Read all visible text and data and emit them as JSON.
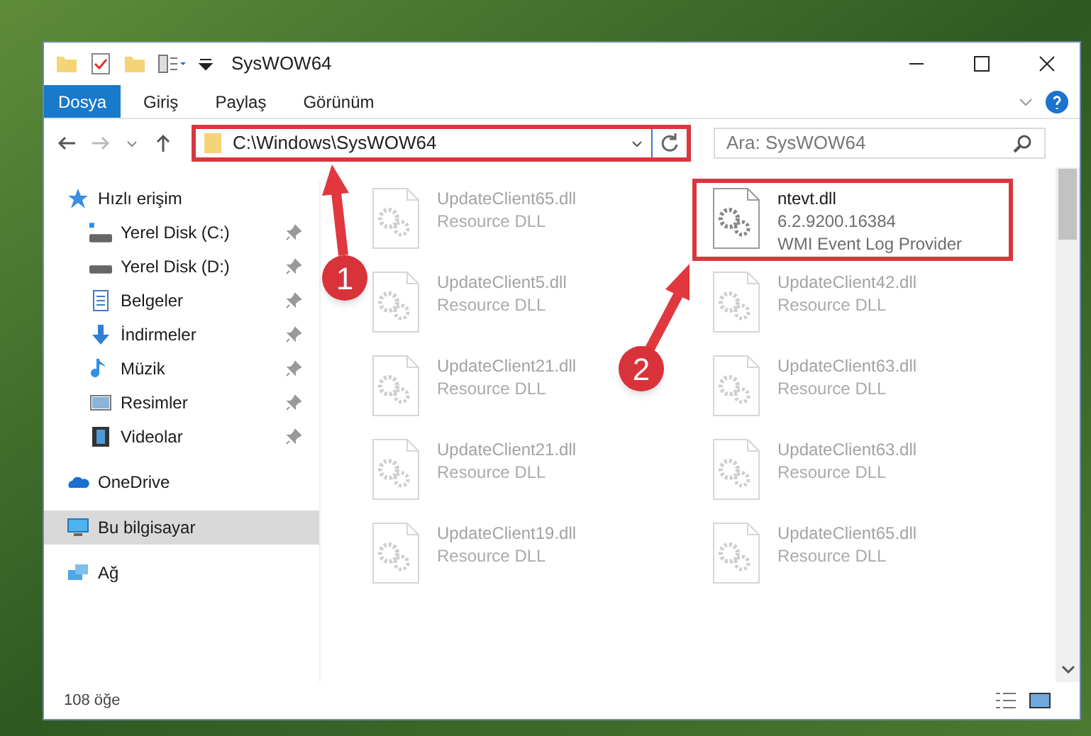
{
  "window": {
    "title": "SysWOW64"
  },
  "ribbon_tabs": [
    {
      "label": "Dosya",
      "selected": true
    },
    {
      "label": "Giriş",
      "selected": false
    },
    {
      "label": "Paylaş",
      "selected": false
    },
    {
      "label": "Görünüm",
      "selected": false
    }
  ],
  "address_bar": {
    "value": "C:\\Windows\\SysWOW64"
  },
  "search": {
    "placeholder": "Ara: SysWOW64"
  },
  "sidebar": {
    "items": [
      {
        "label": "Hızlı erişim",
        "kind": "star",
        "selected": false,
        "children": [
          {
            "label": "Yerel Disk (C:)",
            "kind": "drive-c",
            "selected": false
          },
          {
            "label": "Yerel Disk (D:)",
            "kind": "drive",
            "selected": false
          },
          {
            "label": "Belgeler",
            "kind": "document",
            "selected": false
          },
          {
            "label": "İndirmeler",
            "kind": "download",
            "selected": false
          },
          {
            "label": "Müzik",
            "kind": "music",
            "selected": false
          },
          {
            "label": "Resimler",
            "kind": "picture",
            "selected": false
          },
          {
            "label": "Videolar",
            "kind": "video",
            "selected": false
          }
        ]
      },
      {
        "label": "OneDrive",
        "kind": "cloud",
        "selected": false
      },
      {
        "label": "Bu bilgisayar",
        "kind": "computer",
        "selected": true
      },
      {
        "label": "Ağ",
        "kind": "network",
        "selected": false
      }
    ]
  },
  "files": [
    {
      "name": "UpdateClient65.dll",
      "lines": [
        "Resource DLL"
      ],
      "faded": true
    },
    {
      "name": "ntevt.dll",
      "lines": [
        "6.2.9200.16384",
        "WMI Event Log Provider"
      ],
      "faded": false
    },
    {
      "name": "UpdateClient5.dll",
      "lines": [
        "Resource DLL"
      ],
      "faded": true
    },
    {
      "name": "UpdateClient42.dll",
      "lines": [
        "Resource DLL"
      ],
      "faded": true
    },
    {
      "name": "UpdateClient21.dll",
      "lines": [
        "Resource DLL"
      ],
      "faded": true
    },
    {
      "name": "UpdateClient63.dll",
      "lines": [
        "Resource DLL"
      ],
      "faded": true
    },
    {
      "name": "UpdateClient21.dll",
      "lines": [
        "Resource DLL"
      ],
      "faded": true
    },
    {
      "name": "UpdateClient63.dll",
      "lines": [
        "Resource DLL"
      ],
      "faded": true
    },
    {
      "name": "UpdateClient19.dll",
      "lines": [
        "Resource DLL"
      ],
      "faded": true
    },
    {
      "name": "UpdateClient65.dll",
      "lines": [
        "Resource DLL"
      ],
      "faded": true
    }
  ],
  "status_bar": {
    "item_count": "108 öğe"
  },
  "annotations": [
    {
      "number": "1"
    },
    {
      "number": "2"
    }
  ]
}
